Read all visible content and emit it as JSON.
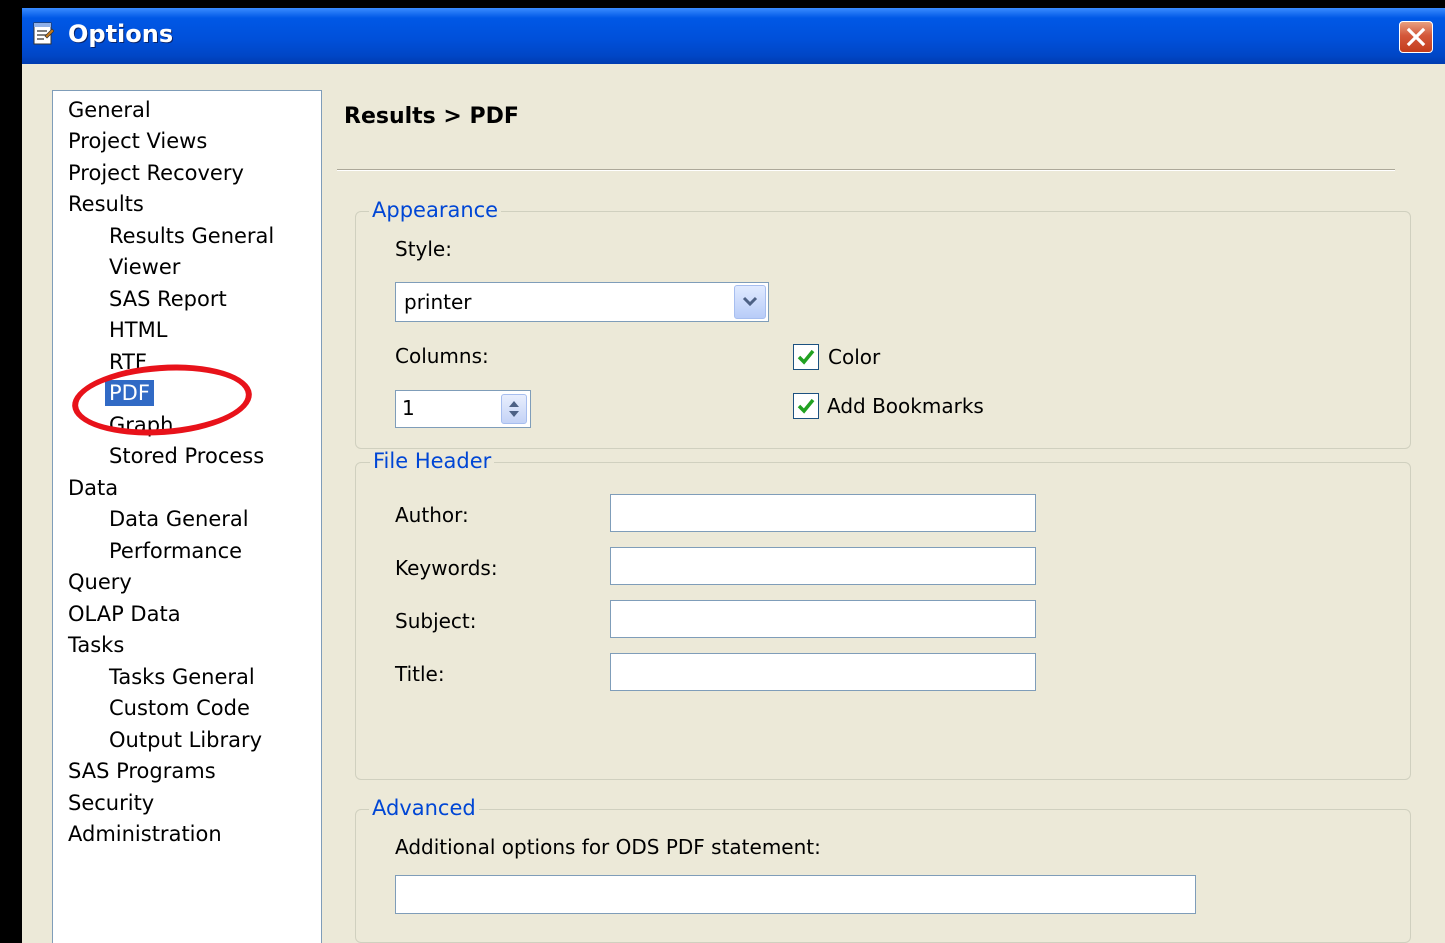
{
  "window": {
    "title": "Options"
  },
  "nav": {
    "items": [
      {
        "label": "General",
        "level": 1
      },
      {
        "label": "Project Views",
        "level": 1
      },
      {
        "label": "Project Recovery",
        "level": 1
      },
      {
        "label": "Results",
        "level": 1
      },
      {
        "label": "Results General",
        "level": 2
      },
      {
        "label": "Viewer",
        "level": 2
      },
      {
        "label": "SAS Report",
        "level": 2
      },
      {
        "label": "HTML",
        "level": 2
      },
      {
        "label": "RTF",
        "level": 2
      },
      {
        "label": "PDF",
        "level": 2,
        "selected": true
      },
      {
        "label": "Graph",
        "level": 2
      },
      {
        "label": "Stored Process",
        "level": 2
      },
      {
        "label": "Data",
        "level": 1
      },
      {
        "label": "Data General",
        "level": 2
      },
      {
        "label": "Performance",
        "level": 2
      },
      {
        "label": "Query",
        "level": 1
      },
      {
        "label": "OLAP Data",
        "level": 1
      },
      {
        "label": "Tasks",
        "level": 1
      },
      {
        "label": "Tasks General",
        "level": 2
      },
      {
        "label": "Custom Code",
        "level": 2
      },
      {
        "label": "Output Library",
        "level": 2
      },
      {
        "label": "SAS Programs",
        "level": 1
      },
      {
        "label": "Security",
        "level": 1
      },
      {
        "label": "Administration",
        "level": 1
      }
    ]
  },
  "content": {
    "heading": "Results > PDF",
    "appearance": {
      "legend": "Appearance",
      "style_label": "Style:",
      "style_value": "printer",
      "columns_label": "Columns:",
      "columns_value": "1",
      "color_label": "Color",
      "color_checked": true,
      "bookmarks_label": "Add Bookmarks",
      "bookmarks_checked": true
    },
    "file_header": {
      "legend": "File Header",
      "author_label": "Author:",
      "author_value": "",
      "keywords_label": "Keywords:",
      "keywords_value": "",
      "subject_label": "Subject:",
      "subject_value": "",
      "title_label": "Title:",
      "title_value": ""
    },
    "advanced": {
      "legend": "Advanced",
      "options_label": "Additional options for ODS PDF statement:",
      "options_value": ""
    }
  },
  "colors": {
    "titlebar": "#0054E3",
    "dialog_bg": "#ECE9D8",
    "selection": "#316AC5",
    "group_legend": "#0046D5",
    "annotation_ring": "#E8121A",
    "checkmark": "#21A121"
  }
}
